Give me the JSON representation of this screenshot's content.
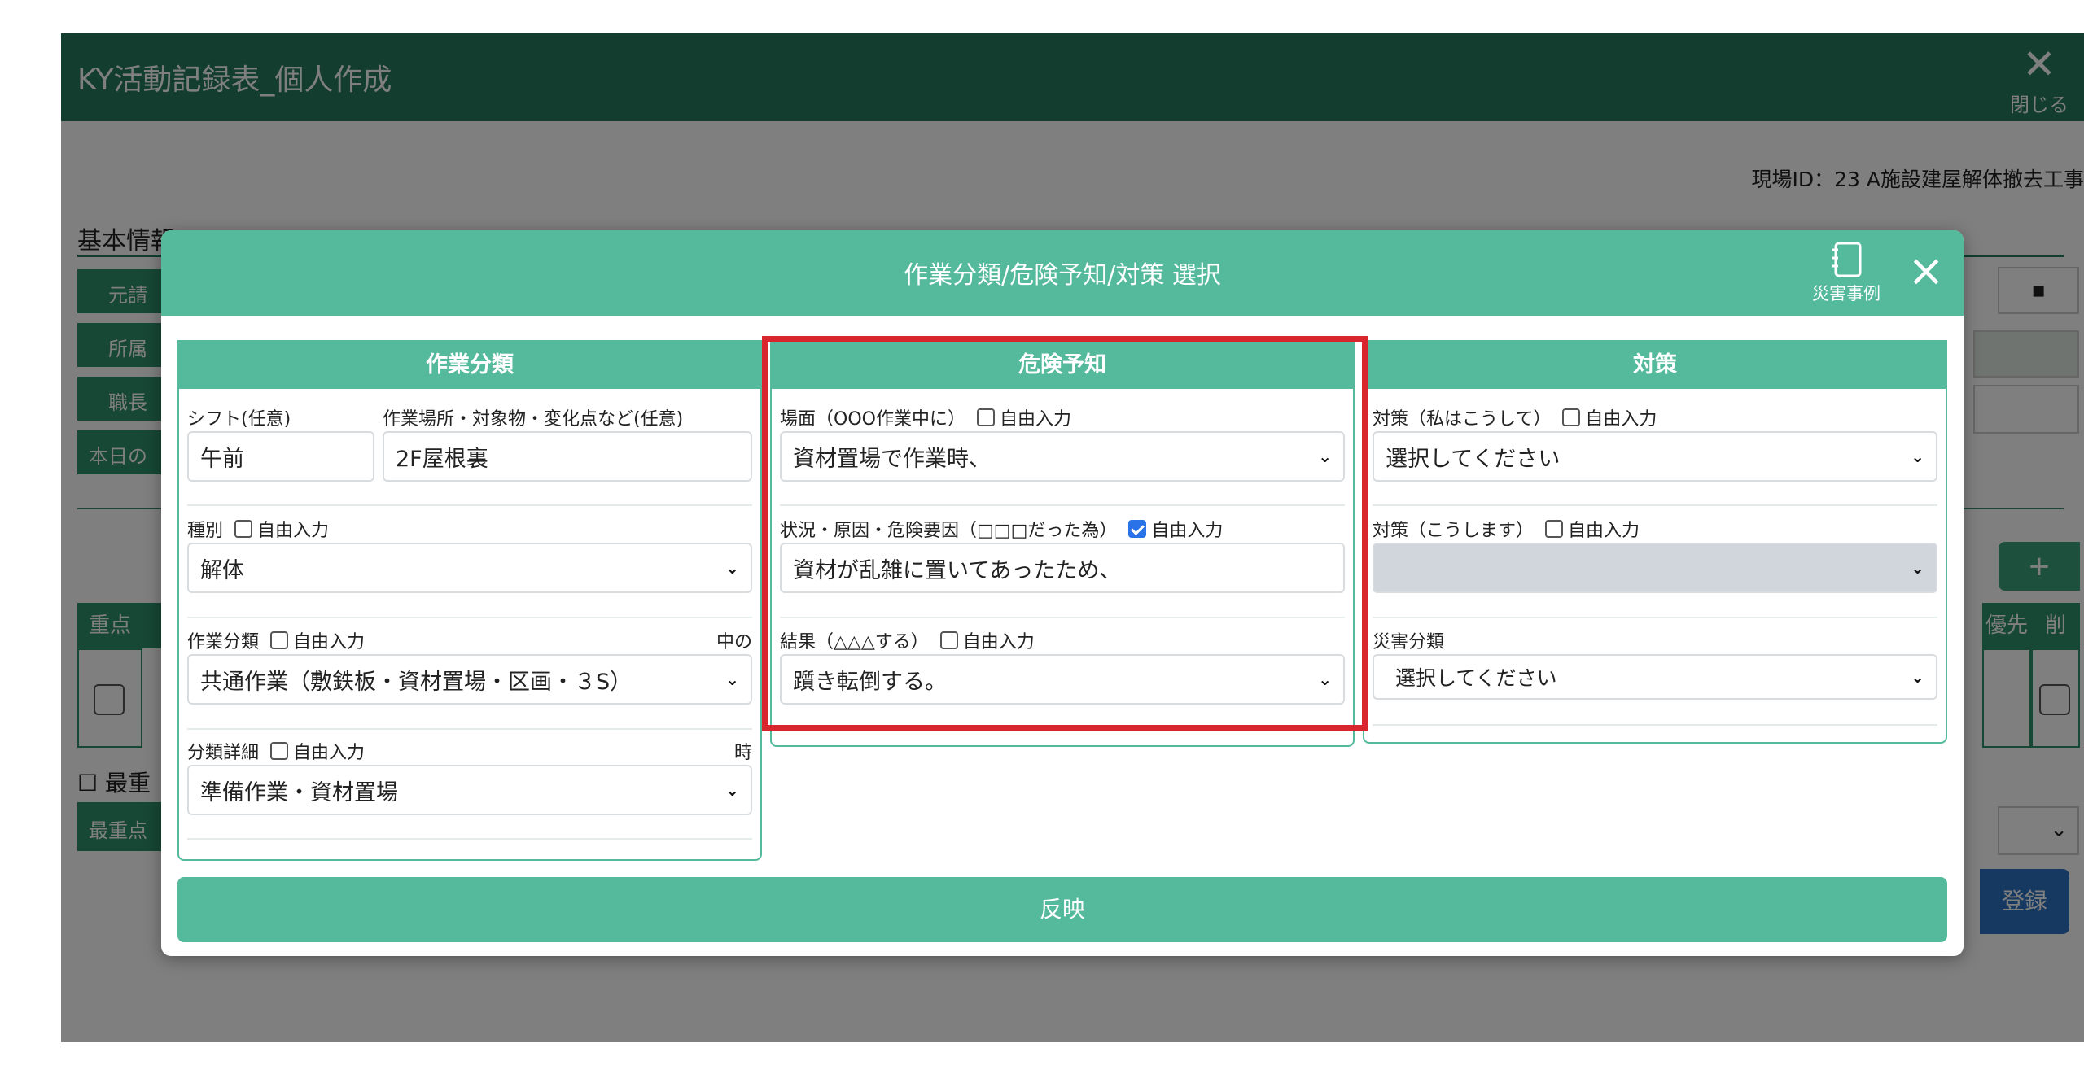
{
  "app": {
    "title": "KY活動記録表_個人作成",
    "close_label": "閉じる",
    "site_id": "現場ID：23 A施設建屋解体撤去工事",
    "basic_info_title": "基本情報",
    "bg_labels": [
      "元請",
      "所属",
      "職長",
      "本日の"
    ],
    "bg_table_headers": [
      "重点",
      "優先",
      "削"
    ],
    "bg_most_label": "最重",
    "bg_most_button": "最重点",
    "bg_add_label": "+",
    "bg_register_label": "登録"
  },
  "modal": {
    "title": "作業分類/危険予知/対策 選択",
    "case_button_label": "災害事例",
    "close_icon": "×",
    "reflect_button_label": "反映",
    "free_input_label": "自由入力",
    "col_work": {
      "header": "作業分類",
      "shift_label": "シフト(任意)",
      "shift_value": "午前",
      "place_label": "作業場所・対象物・変化点など(任意)",
      "place_value": "2F屋根裏",
      "type_label": "種別",
      "type_value": "解体",
      "category_label": "作業分類",
      "category_note": "中の",
      "category_value": "共通作業（敷鉄板・資材置場・区画・３S）",
      "detail_label": "分類詳細",
      "detail_note": "時",
      "detail_value": "準備作業・資材置場"
    },
    "col_danger": {
      "header": "危険予知",
      "scene_label": "場面（OOO作業中に）",
      "scene_value": "資材置場で作業時、",
      "cause_label": "状況・原因・危険要因（□□□だった為）",
      "cause_value": "資材が乱雑に置いてあったため、",
      "cause_free_checked": true,
      "result_label": "結果（△△△する）",
      "result_value": "躓き転倒する。"
    },
    "col_measure": {
      "header": "対策",
      "measure1_label": "対策（私はこうして）",
      "measure1_value": "選択してください",
      "measure2_label": "対策（こうします）",
      "measure2_value": "",
      "disaster_label": "災害分類",
      "disaster_value": "選択してください"
    }
  },
  "colors": {
    "header_dark": "#257a5e",
    "modal_accent": "#55ba9b",
    "highlight": "#d9262e",
    "register_blue": "#2a72c2"
  }
}
